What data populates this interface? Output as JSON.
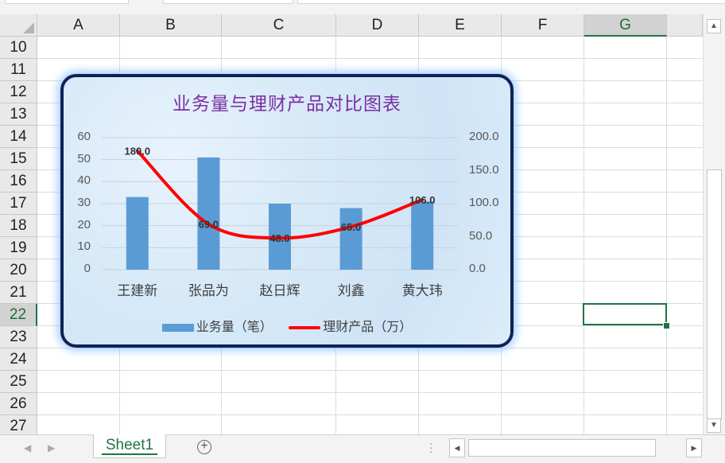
{
  "columns": [
    "A",
    "B",
    "C",
    "D",
    "E",
    "F",
    "G"
  ],
  "selected_column": "G",
  "rows": [
    "10",
    "11",
    "12",
    "13",
    "14",
    "15",
    "16",
    "17",
    "18",
    "19",
    "20",
    "21",
    "22",
    "23",
    "24",
    "25",
    "26",
    "27"
  ],
  "selected_row": "22",
  "sheet": {
    "active_tab": "Sheet1"
  },
  "colors": {
    "accent": "#217346",
    "bar": "#5b9bd5",
    "line": "#ff0000",
    "title": "#7a2fa3",
    "chart_border": "#0f2255"
  },
  "icons": {
    "add_sheet": "plus-circle-icon",
    "scroll_up": "triangle-up-icon",
    "scroll_down": "triangle-down-icon"
  },
  "chart_data": {
    "type": "bar",
    "title": "业务量与理财产品对比图表",
    "categories": [
      "王建新",
      "张品为",
      "赵日辉",
      "刘鑫",
      "黄大玮"
    ],
    "series": [
      {
        "name": "业务量（笔）",
        "type": "bar",
        "axis": "left",
        "values": [
          33,
          51,
          30,
          28,
          31
        ]
      },
      {
        "name": "理财产品（万）",
        "type": "line",
        "axis": "right",
        "values": [
          180.0,
          69.0,
          48.0,
          65.0,
          106.0
        ],
        "data_labels": [
          "180.0",
          "69.0",
          "48.0",
          "65.0",
          "106.0"
        ]
      }
    ],
    "y_left": {
      "ylim": [
        0,
        60
      ],
      "ticks": [
        "0",
        "10",
        "20",
        "30",
        "40",
        "50",
        "60"
      ]
    },
    "y_right": {
      "ylim": [
        0,
        200
      ],
      "ticks": [
        "0.0",
        "50.0",
        "100.0",
        "150.0",
        "200.0"
      ]
    },
    "grid": true,
    "legend": "bottom"
  }
}
